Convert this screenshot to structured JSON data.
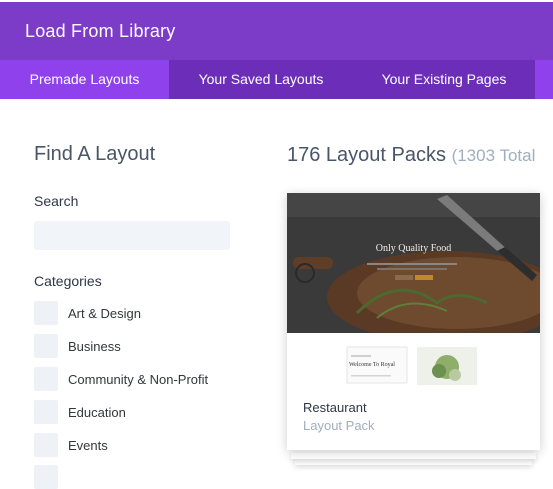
{
  "header": {
    "title": "Load From Library"
  },
  "tabs": [
    {
      "label": "Premade Layouts",
      "active": true
    },
    {
      "label": "Your Saved Layouts",
      "active": false
    },
    {
      "label": "Your Existing Pages",
      "active": false
    }
  ],
  "sidebar": {
    "title": "Find A Layout",
    "search": {
      "label": "Search",
      "value": "",
      "placeholder": ""
    },
    "categories_label": "Categories",
    "categories": [
      "Art & Design",
      "Business",
      "Community & Non-Profit",
      "Education",
      "Events"
    ]
  },
  "main": {
    "title": "176 Layout Packs",
    "total": "(1303 Total",
    "cards": [
      {
        "name": "Restaurant",
        "subtitle": "Layout Pack",
        "hero_text": "Only Quality Food",
        "preview_text": "Welcome To Royal"
      }
    ]
  },
  "colors": {
    "header": "#7d3cc8",
    "tabs_bg": "#6c2eb9",
    "tab_active": "#8f42ec"
  }
}
